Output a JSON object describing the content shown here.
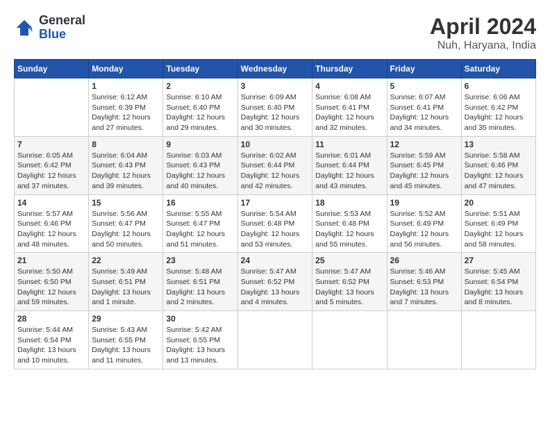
{
  "header": {
    "logo_general": "General",
    "logo_blue": "Blue",
    "title": "April 2024",
    "subtitle": "Nuh, Haryana, India"
  },
  "columns": [
    "Sunday",
    "Monday",
    "Tuesday",
    "Wednesday",
    "Thursday",
    "Friday",
    "Saturday"
  ],
  "weeks": [
    [
      {
        "day": "",
        "info": ""
      },
      {
        "day": "1",
        "info": "Sunrise: 6:12 AM\nSunset: 6:39 PM\nDaylight: 12 hours\nand 27 minutes."
      },
      {
        "day": "2",
        "info": "Sunrise: 6:10 AM\nSunset: 6:40 PM\nDaylight: 12 hours\nand 29 minutes."
      },
      {
        "day": "3",
        "info": "Sunrise: 6:09 AM\nSunset: 6:40 PM\nDaylight: 12 hours\nand 30 minutes."
      },
      {
        "day": "4",
        "info": "Sunrise: 6:08 AM\nSunset: 6:41 PM\nDaylight: 12 hours\nand 32 minutes."
      },
      {
        "day": "5",
        "info": "Sunrise: 6:07 AM\nSunset: 6:41 PM\nDaylight: 12 hours\nand 34 minutes."
      },
      {
        "day": "6",
        "info": "Sunrise: 6:06 AM\nSunset: 6:42 PM\nDaylight: 12 hours\nand 35 minutes."
      }
    ],
    [
      {
        "day": "7",
        "info": "Sunrise: 6:05 AM\nSunset: 6:42 PM\nDaylight: 12 hours\nand 37 minutes."
      },
      {
        "day": "8",
        "info": "Sunrise: 6:04 AM\nSunset: 6:43 PM\nDaylight: 12 hours\nand 39 minutes."
      },
      {
        "day": "9",
        "info": "Sunrise: 6:03 AM\nSunset: 6:43 PM\nDaylight: 12 hours\nand 40 minutes."
      },
      {
        "day": "10",
        "info": "Sunrise: 6:02 AM\nSunset: 6:44 PM\nDaylight: 12 hours\nand 42 minutes."
      },
      {
        "day": "11",
        "info": "Sunrise: 6:01 AM\nSunset: 6:44 PM\nDaylight: 12 hours\nand 43 minutes."
      },
      {
        "day": "12",
        "info": "Sunrise: 5:59 AM\nSunset: 6:45 PM\nDaylight: 12 hours\nand 45 minutes."
      },
      {
        "day": "13",
        "info": "Sunrise: 5:58 AM\nSunset: 6:46 PM\nDaylight: 12 hours\nand 47 minutes."
      }
    ],
    [
      {
        "day": "14",
        "info": "Sunrise: 5:57 AM\nSunset: 6:46 PM\nDaylight: 12 hours\nand 48 minutes."
      },
      {
        "day": "15",
        "info": "Sunrise: 5:56 AM\nSunset: 6:47 PM\nDaylight: 12 hours\nand 50 minutes."
      },
      {
        "day": "16",
        "info": "Sunrise: 5:55 AM\nSunset: 6:47 PM\nDaylight: 12 hours\nand 51 minutes."
      },
      {
        "day": "17",
        "info": "Sunrise: 5:54 AM\nSunset: 6:48 PM\nDaylight: 12 hours\nand 53 minutes."
      },
      {
        "day": "18",
        "info": "Sunrise: 5:53 AM\nSunset: 6:48 PM\nDaylight: 12 hours\nand 55 minutes."
      },
      {
        "day": "19",
        "info": "Sunrise: 5:52 AM\nSunset: 6:49 PM\nDaylight: 12 hours\nand 56 minutes."
      },
      {
        "day": "20",
        "info": "Sunrise: 5:51 AM\nSunset: 6:49 PM\nDaylight: 12 hours\nand 58 minutes."
      }
    ],
    [
      {
        "day": "21",
        "info": "Sunrise: 5:50 AM\nSunset: 6:50 PM\nDaylight: 12 hours\nand 59 minutes."
      },
      {
        "day": "22",
        "info": "Sunrise: 5:49 AM\nSunset: 6:51 PM\nDaylight: 13 hours\nand 1 minute."
      },
      {
        "day": "23",
        "info": "Sunrise: 5:48 AM\nSunset: 6:51 PM\nDaylight: 13 hours\nand 2 minutes."
      },
      {
        "day": "24",
        "info": "Sunrise: 5:47 AM\nSunset: 6:52 PM\nDaylight: 13 hours\nand 4 minutes."
      },
      {
        "day": "25",
        "info": "Sunrise: 5:47 AM\nSunset: 6:52 PM\nDaylight: 13 hours\nand 5 minutes."
      },
      {
        "day": "26",
        "info": "Sunrise: 5:46 AM\nSunset: 6:53 PM\nDaylight: 13 hours\nand 7 minutes."
      },
      {
        "day": "27",
        "info": "Sunrise: 5:45 AM\nSunset: 6:54 PM\nDaylight: 13 hours\nand 8 minutes."
      }
    ],
    [
      {
        "day": "28",
        "info": "Sunrise: 5:44 AM\nSunset: 6:54 PM\nDaylight: 13 hours\nand 10 minutes."
      },
      {
        "day": "29",
        "info": "Sunrise: 5:43 AM\nSunset: 6:55 PM\nDaylight: 13 hours\nand 11 minutes."
      },
      {
        "day": "30",
        "info": "Sunrise: 5:42 AM\nSunset: 6:55 PM\nDaylight: 13 hours\nand 13 minutes."
      },
      {
        "day": "",
        "info": ""
      },
      {
        "day": "",
        "info": ""
      },
      {
        "day": "",
        "info": ""
      },
      {
        "day": "",
        "info": ""
      }
    ]
  ]
}
